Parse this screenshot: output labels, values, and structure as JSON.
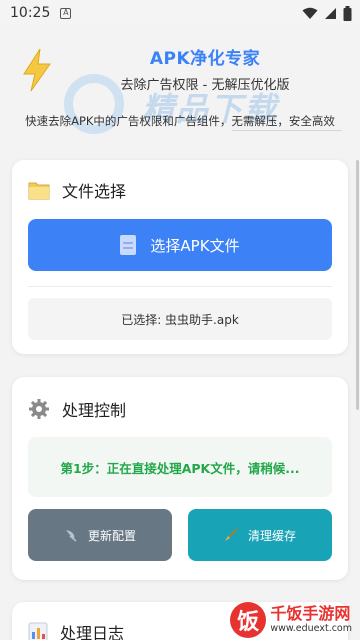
{
  "status_bar": {
    "time": "10:25",
    "notification_letter": "A"
  },
  "header": {
    "title": "APK净化专家",
    "subtitle": "去除广告权限 - 无解压优化版",
    "description": "快速去除APK中的广告权限和广告组件，无需解压，安全高效"
  },
  "watermark": {
    "text": "精品下载"
  },
  "file_card": {
    "title": "文件选择",
    "select_button": "选择APK文件",
    "selected_label": "已选择: 虫虫助手.apk"
  },
  "control_card": {
    "title": "处理控制",
    "step_status": "第1步：正在直接处理APK文件，请稍候...",
    "update_button": "更新配置",
    "clear_button": "清理缓存"
  },
  "log_card": {
    "title": "处理日志"
  },
  "site_logo": {
    "badge": "饭",
    "name": "千饭手游网",
    "url": "www.eduext.com"
  },
  "colors": {
    "primary": "#3c82f6",
    "success": "#22a84a",
    "gray_button": "#687784",
    "teal_button": "#18a3b6"
  }
}
